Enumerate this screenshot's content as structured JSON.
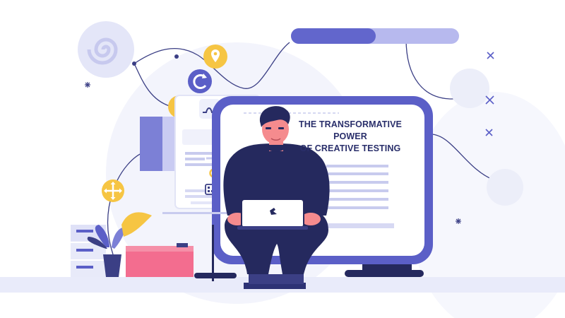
{
  "headline": {
    "line1": "THE TRANSFORMATIVE POWER",
    "line2": "OF CREATIVE TESTING"
  },
  "colors": {
    "navy": "#25295e",
    "indigo": "#5b5fc7",
    "lavender": "#c9cbf2",
    "pale": "#eef0fb",
    "yellow": "#f6c543",
    "pink": "#f36d8f",
    "skin": "#f58b8e"
  },
  "icons": [
    "spiral-icon",
    "pin-icon",
    "refresh-icon",
    "walk-icon",
    "wave-icon",
    "key-icon",
    "zoom-icon",
    "qr-icon",
    "move-icon",
    "laptop-logo-icon",
    "close-icon",
    "sparkle-icon"
  ]
}
